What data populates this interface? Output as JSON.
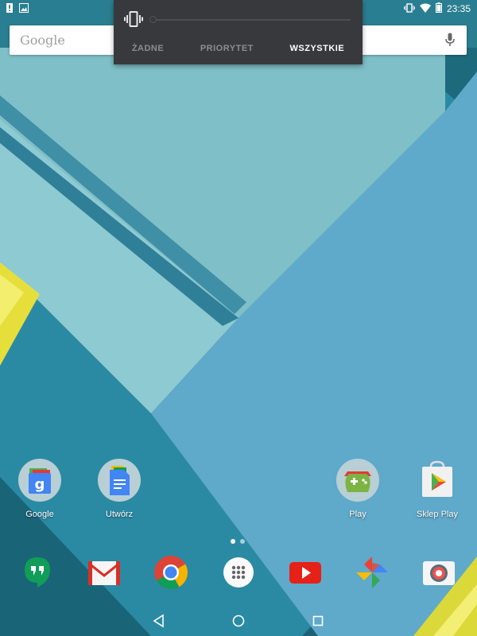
{
  "status_bar": {
    "time": "23:35",
    "icons": [
      "alert-icon",
      "image-icon",
      "vibrate-icon",
      "wifi-icon",
      "battery-icon"
    ]
  },
  "search": {
    "logo_text": "Google",
    "icon": "mic-icon"
  },
  "volume_panel": {
    "mode_icon": "vibrate-icon",
    "tabs": [
      {
        "label": "ŻADNE",
        "active": false
      },
      {
        "label": "PRIORYTET",
        "active": false
      },
      {
        "label": "WSZYSTKIE",
        "active": true
      }
    ],
    "colors": {
      "background": "#37393d",
      "active": "#ffffff",
      "inactive": "#8a8d92"
    }
  },
  "home_apps": [
    {
      "label": "Google",
      "icon": "google-folder-icon"
    },
    {
      "label": "Utwórz",
      "icon": "create-folder-icon"
    },
    {
      "label": "Play",
      "icon": "play-folder-icon"
    },
    {
      "label": "Sklep Play",
      "icon": "play-store-icon"
    }
  ],
  "pages": {
    "count": 2,
    "current": 1
  },
  "dock": [
    "hangouts-icon",
    "gmail-icon",
    "chrome-icon",
    "app-drawer-icon",
    "youtube-icon",
    "photos-icon",
    "camera-icon"
  ],
  "nav": [
    "back-icon",
    "home-icon",
    "recents-icon"
  ]
}
